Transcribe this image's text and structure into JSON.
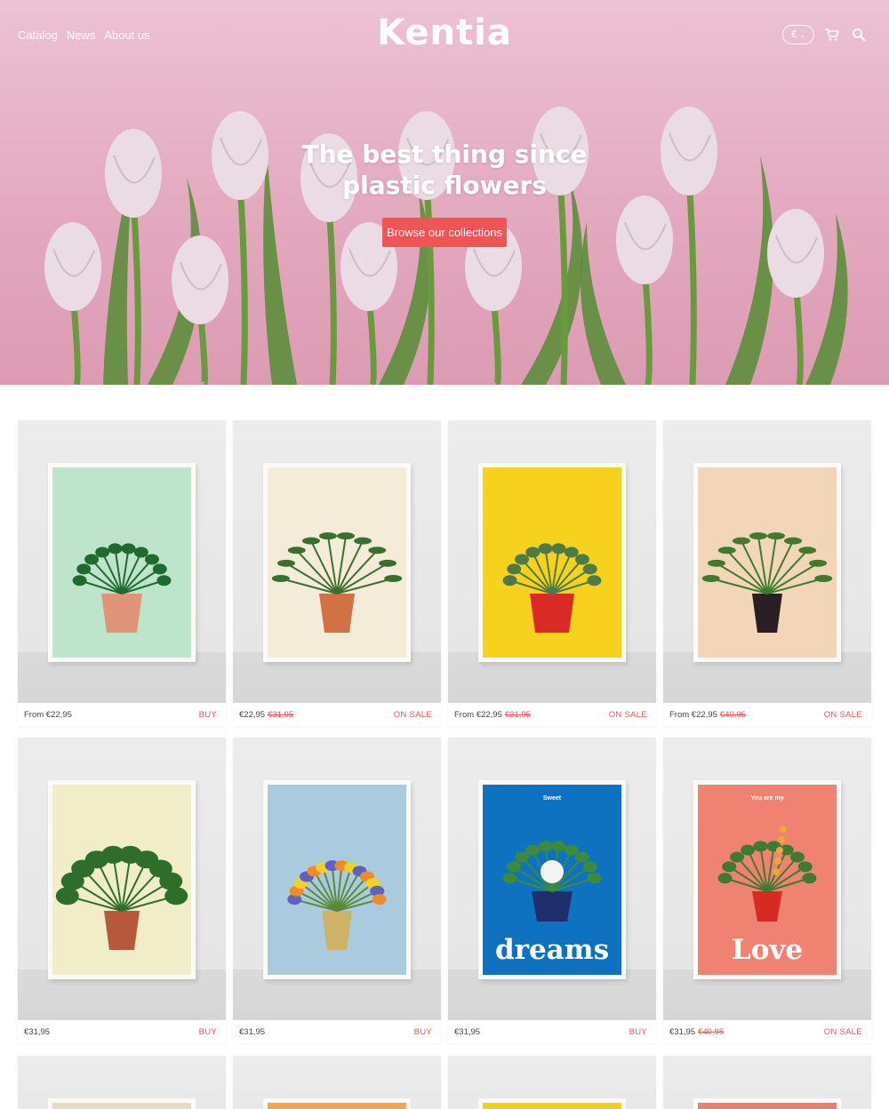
{
  "nav": {
    "links": [
      "Catalog",
      "News",
      "About us"
    ],
    "logo": "Kentia",
    "currency": "€",
    "icons": [
      "cart-icon",
      "search-icon"
    ]
  },
  "hero": {
    "title_line1": "The best thing since",
    "title_line2": "plastic flowers",
    "button": "Browse our collections"
  },
  "colors": {
    "accent": "#f05454",
    "hero_bg": "#e3a9bf"
  },
  "products": [
    {
      "price": "From €22,95",
      "old_price": "",
      "tag": "BUY",
      "poster_bg": "#bfe4cc",
      "plant": "zz-plant-terracotta"
    },
    {
      "price": "€22,95",
      "old_price": "€31,95",
      "tag": "ON SALE",
      "poster_bg": "#f4ecd8",
      "plant": "kentia-palm-terracotta"
    },
    {
      "price": "From €22,95",
      "old_price": "€31,95",
      "tag": "ON SALE",
      "poster_bg": "#f6d21e",
      "plant": "calathea-red-pot"
    },
    {
      "price": "From €22,95",
      "old_price": "€40,95",
      "tag": "ON SALE",
      "poster_bg": "#f3d5b8",
      "plant": "fan-palm-black-pot"
    },
    {
      "price": "€31,95",
      "old_price": "",
      "tag": "BUY",
      "poster_bg": "#f1edc8",
      "plant": "monstera-terracotta"
    },
    {
      "price": "€31,95",
      "old_price": "",
      "tag": "BUY",
      "poster_bg": "#a9cbdd",
      "plant": "bouquet-gold-vase"
    },
    {
      "price": "€31,95",
      "old_price": "",
      "tag": "BUY",
      "poster_bg": "#0f72c0",
      "plant": "chrysanthemum-navy-pot",
      "poster_top": "Sweet",
      "poster_word": "dreams"
    },
    {
      "price": "€31,95",
      "old_price": "€40,95",
      "tag": "ON SALE",
      "poster_bg": "#ef8270",
      "plant": "orchid-red-pot",
      "poster_top": "You are my",
      "poster_word": "Love"
    }
  ],
  "partial_row_colors": [
    "#e9dcc6",
    "#f0a64a",
    "#f2d116",
    "#e97f6e"
  ]
}
